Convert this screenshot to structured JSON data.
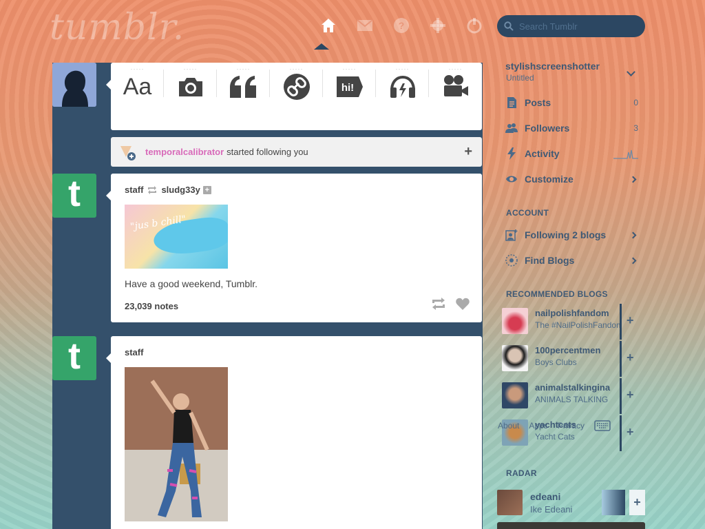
{
  "header": {
    "logo": "tumblr.",
    "search_placeholder": "Search Tumblr"
  },
  "topnav": [
    "home-icon",
    "inbox-icon",
    "help-icon",
    "settings-icon",
    "logout-icon"
  ],
  "post_types": [
    {
      "label": "Text",
      "icon": "text-icon"
    },
    {
      "label": "Photo",
      "icon": "camera-icon"
    },
    {
      "label": "Quote",
      "icon": "quote-icon"
    },
    {
      "label": "Link",
      "icon": "link-icon"
    },
    {
      "label": "Chat",
      "icon": "chat-icon"
    },
    {
      "label": "Audio",
      "icon": "headphones-icon"
    },
    {
      "label": "Video",
      "icon": "video-icon"
    }
  ],
  "post_type_text_glyph": "Aa",
  "post_type_chat_glyph": "hi!",
  "notification": {
    "user": "temporalcalibrator",
    "text": "started following you",
    "add": "+"
  },
  "posts": [
    {
      "author": "staff",
      "reblogged_from": "sludg33y",
      "image_text": "\"jus b chill\"",
      "caption": "Have a good weekend, Tumblr.",
      "notes": "23,039 notes"
    },
    {
      "author": "staff"
    }
  ],
  "avatar_letter": "t",
  "sidebar": {
    "blog_name": "stylishscreenshotter",
    "blog_subtitle": "Untitled",
    "items": [
      {
        "label": "Posts",
        "count": "0"
      },
      {
        "label": "Followers",
        "count": "3"
      },
      {
        "label": "Activity"
      },
      {
        "label": "Customize"
      }
    ],
    "account_heading": "ACCOUNT",
    "account_items": [
      {
        "label": "Following 2 blogs"
      },
      {
        "label": "Find Blogs"
      }
    ],
    "recommended_heading": "RECOMMENDED BLOGS",
    "recommended": [
      {
        "name": "nailpolishfandom",
        "desc": "The #NailPolishFandom",
        "color": "#e26d7e"
      },
      {
        "name": "100percentmen",
        "desc": "Boys Clubs",
        "color": "#2b2b2b"
      },
      {
        "name": "animalstalkingina",
        "desc": "ANIMALS TALKING",
        "color": "#4e6a86"
      },
      {
        "name": "yachtcats",
        "desc": "Yacht Cats",
        "color": "#c69057"
      }
    ],
    "footer": [
      "About",
      "Apps",
      "Privacy"
    ],
    "radar_heading": "RADAR",
    "radar": {
      "name": "edeani",
      "desc": "Ike Edeani"
    }
  }
}
